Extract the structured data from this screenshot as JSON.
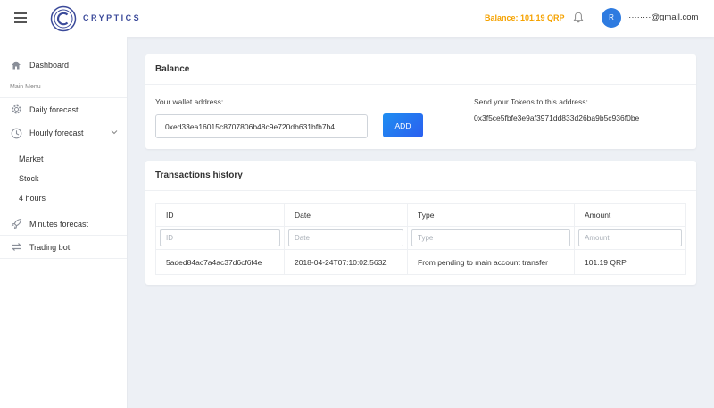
{
  "header": {
    "brand": "CRYPTICS",
    "balance": "Balance: 101.19 QRP",
    "avatar_letter": "R",
    "user_email": "·········@gmail.com"
  },
  "sidebar": {
    "dashboard": "Dashboard",
    "section_label": "Main Menu",
    "daily_forecast": "Daily forecast",
    "hourly_forecast": "Hourly forecast",
    "sub_items": [
      "Market",
      "Stock",
      "4 hours"
    ],
    "minutes_forecast": "Minutes forecast",
    "trading_bot": "Trading bot"
  },
  "balance_card": {
    "title": "Balance",
    "wallet_label": "Your wallet address:",
    "wallet_value": "0xed33ea16015c8707806b48c9e720db631bfb7b4",
    "add_label": "ADD",
    "send_label": "Send your Tokens to this address:",
    "send_address": "0x3f5ce5fbfe3e9af3971dd833d26ba9b5c936f0be"
  },
  "transactions": {
    "title": "Transactions history",
    "columns": [
      "ID",
      "Date",
      "Type",
      "Amount"
    ],
    "filter_placeholders": [
      "ID",
      "Date",
      "Type",
      "Amount"
    ],
    "rows": [
      {
        "id": "5aded84ac7a4ac37d6cf6f4e",
        "date": "2018-04-24T07:10:02.563Z",
        "type": "From pending to main account transfer",
        "amount": "101.19 QRP"
      }
    ]
  },
  "colors": {
    "accent_blue": "#2b5ff0",
    "balance_orange": "#f5a200",
    "brand_navy": "#3b4a9a"
  }
}
